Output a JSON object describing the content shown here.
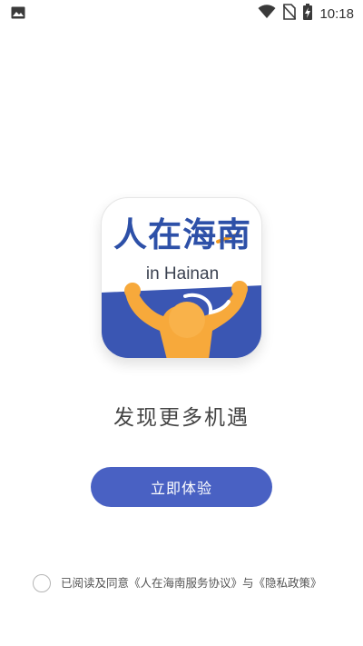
{
  "status_bar": {
    "time": "10:18",
    "icons": [
      "image-icon",
      "wifi-icon",
      "no-sim-icon",
      "battery-charging-icon"
    ]
  },
  "app_icon": {
    "title": "人在海南",
    "subtitle": "in Hainan",
    "colors": {
      "blue": "#2d50a8",
      "orange": "#f7a93b",
      "accent": "#f39a1f"
    }
  },
  "tagline": "发现更多机遇",
  "cta_button": {
    "label": "立即体验",
    "color": "#4961c3"
  },
  "agreement": {
    "prefix": "已阅读及同意",
    "service_link": "《人在海南服务协议》",
    "connector": "与",
    "privacy_link": "《隐私政策》",
    "checked": false
  }
}
